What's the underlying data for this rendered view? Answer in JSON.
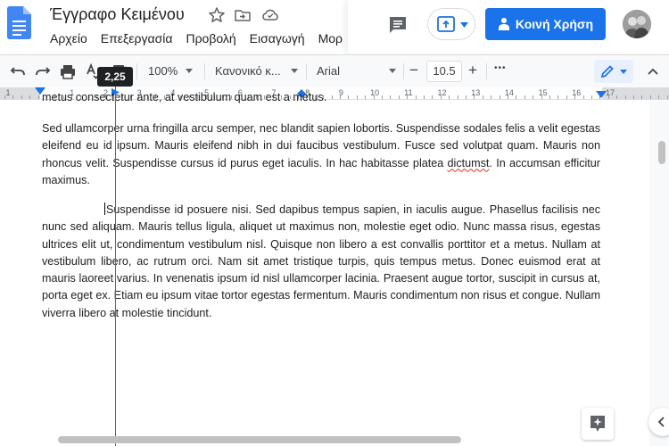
{
  "title": "Έγγραφο Κειμένου",
  "menu": [
    "Αρχείο",
    "Επεξεργασία",
    "Προβολή",
    "Εισαγωγή",
    "Μορ"
  ],
  "share_label": "Κοινή Χρήση",
  "toolbar": {
    "zoom": "100%",
    "style": "Κανονικό κ...",
    "font": "Arial",
    "font_size": "10.5",
    "minus": "−",
    "plus": "+",
    "more": "•••"
  },
  "tooltip": "2,25",
  "ruler": {
    "numbers": [
      "1",
      "1",
      "2",
      "3",
      "4",
      "5",
      "6",
      "7",
      "8",
      "9",
      "10",
      "11",
      "12",
      "13",
      "14",
      "15",
      "16",
      "17"
    ]
  },
  "document": {
    "cut_line": "metus consectetur ante, at vestibulum quam est a metus.",
    "para1_before": "Sed ullamcorper urna fringilla arcu semper, nec blandit sapien lobortis. Suspendisse sodales felis  a velit egestas eleifend eu id ipsum. Mauris eleifend nibh in dui faucibus vestibulum. Fusce sed volutpat quam. Mauris non rhoncus velit. Suspendisse cursus id purus eget iaculis. In hac  habitasse platea ",
    "para1_error": "dictumst",
    "para1_after": ". In accumsan efficitur maximus.",
    "para2_indent": "                ",
    "para2": "Suspendisse id posuere nisi. Sed dapibus tempus sapien, in iaculis augue. Phasellus facilisis nec  nunc sed aliquam. Mauris tellus ligula, aliquet ut maximus non, molestie eget odio. Nunc massa  risus, egestas ultrices elit ut, condimentum vestibulum nisl. Quisque non libero a est convallis porttitor et a metus. Nullam at vestibulum libero, ac rutrum orci. Nam sit amet tristique turpis,  quis tempus metus. Donec euismod erat at mauris laoreet varius. In venenatis ipsum id nisl  ullamcorper lacinia. Praesent augue tortor, suscipit in cursus at, porta eget ex. Etiam eu ipsum  vitae tortor egestas fermentum. Mauris condimentum non risus et congue. Nullam viverra libero  at molestie tincidunt."
  },
  "colors": {
    "accent": "#1a73e8",
    "doc_blue": "#4285f4",
    "error": "#d93025"
  },
  "icons": [
    "docs-logo",
    "star-icon",
    "move-folder-icon",
    "cloud-saved-icon",
    "comment-icon",
    "present-icon",
    "share-lock-icon",
    "avatar",
    "undo-icon",
    "redo-icon",
    "print-icon",
    "spellcheck-icon",
    "paint-format-icon",
    "more-icon",
    "edit-mode-icon",
    "collapse-icon",
    "explore-icon",
    "side-panel-icon"
  ]
}
